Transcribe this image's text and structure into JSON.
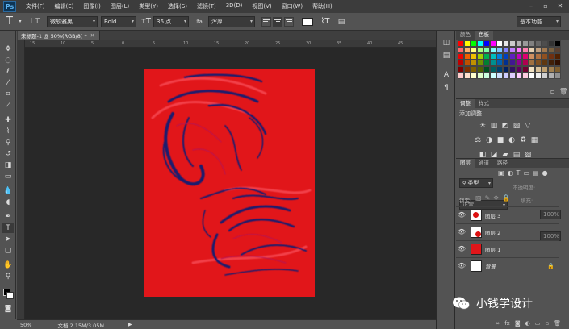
{
  "app_logo": "Ps",
  "menu": [
    "文件(F)",
    "编辑(E)",
    "图像(I)",
    "图层(L)",
    "类型(Y)",
    "选择(S)",
    "滤镜(T)",
    "3D(D)",
    "视图(V)",
    "窗口(W)",
    "帮助(H)"
  ],
  "options": {
    "font_family": "微软雅黑",
    "font_style": "Bold",
    "font_size": "36 点",
    "antialias": "浑厚",
    "workspace": "基本功能"
  },
  "document": {
    "tab_title": "未标题-1 @ 50%(RGB/8) *",
    "ruler_marks": [
      "15",
      "10",
      "5",
      "0",
      "5",
      "10",
      "15",
      "20",
      "25",
      "30",
      "35",
      "40",
      "45"
    ],
    "zoom": "50%",
    "doc_size": "文档:2.15M/3.05M"
  },
  "swatches": {
    "tabs": [
      "颜色",
      "色板"
    ],
    "colors": [
      "#ff0000",
      "#ffff00",
      "#00ff00",
      "#00ffff",
      "#0000ff",
      "#ff00ff",
      "#ffffff",
      "#e6e6e6",
      "#cccccc",
      "#b3b3b3",
      "#999999",
      "#808080",
      "#666666",
      "#4d4d4d",
      "#333333",
      "#000000",
      "#ff6a6a",
      "#ffb06a",
      "#ffff80",
      "#aaff80",
      "#80ffaa",
      "#80ffff",
      "#80c8ff",
      "#8080ff",
      "#c080ff",
      "#ff80ff",
      "#ff80b0",
      "#e6d0b0",
      "#c0a080",
      "#a07850",
      "#786040",
      "#5a4030",
      "#f00000",
      "#f06000",
      "#f0c000",
      "#a0d000",
      "#00b050",
      "#00c0c0",
      "#0080e0",
      "#0040c0",
      "#6020c0",
      "#c000c0",
      "#e00070",
      "#d09060",
      "#b07040",
      "#905020",
      "#703010",
      "#502000",
      "#c00000",
      "#c05000",
      "#c09000",
      "#709000",
      "#008030",
      "#009090",
      "#0060b0",
      "#003090",
      "#401890",
      "#900090",
      "#b00050",
      "#a07040",
      "#805020",
      "#603810",
      "#402008",
      "#301000",
      "#800000",
      "#803000",
      "#806000",
      "#506000",
      "#005020",
      "#006060",
      "#004070",
      "#002060",
      "#301060",
      "#600060",
      "#700030",
      "#f0e0c0",
      "#d8c098",
      "#c0a070",
      "#a08050",
      "#806030",
      "#ffcccc",
      "#ffe0cc",
      "#ffffcc",
      "#e0ffcc",
      "#ccffe0",
      "#ccffff",
      "#cce0ff",
      "#ccccff",
      "#e0ccff",
      "#ffccff",
      "#ffcce0",
      "#ffffff",
      "#f0f0f0",
      "#d0d0d0",
      "#b0b0b0",
      "#909090"
    ]
  },
  "adjustments": {
    "tabs": [
      "调整",
      "样式"
    ],
    "title": "添加调整",
    "row1": [
      "☀",
      "▥",
      "◩",
      "▧",
      "▽"
    ],
    "row2": [
      "⚖",
      "◑",
      "■",
      "◐",
      "♻",
      "▦"
    ],
    "row3": [
      "◧",
      "◪",
      "▰",
      "▤",
      "▨"
    ]
  },
  "layers": {
    "tabs": [
      "图层",
      "通道",
      "路径"
    ],
    "filter_kind": "类型",
    "blend_mode": "正常",
    "opacity_label": "不透明度:",
    "opacity_value": "100%",
    "lock_label": "锁定:",
    "fill_label": "填充:",
    "fill_value": "100%",
    "items": [
      {
        "name": "图层 3",
        "thumb": "dot"
      },
      {
        "name": "图层 2",
        "thumb": "dot2"
      },
      {
        "name": "图层 1",
        "thumb": "red"
      },
      {
        "name": "背景",
        "thumb": "white",
        "locked": true
      }
    ]
  },
  "watermark": "小钱学设计",
  "colors": {
    "canvas_red": "#e1161a",
    "swirl": "#1b1f6e",
    "bg_dark": "#282828"
  }
}
